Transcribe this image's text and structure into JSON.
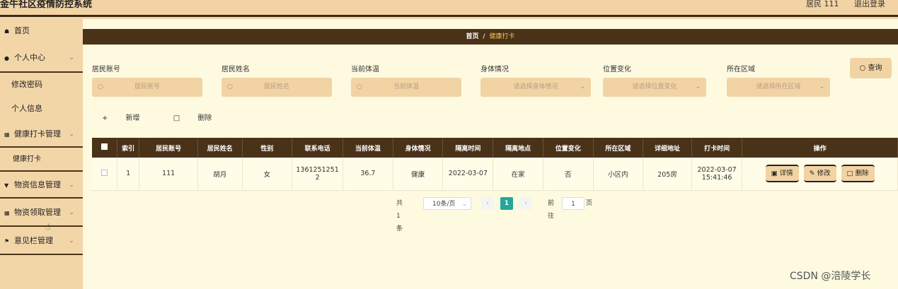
{
  "header": {
    "title": "金牛社区疫情防控系统",
    "user": "居民 111",
    "logout": "退出登录"
  },
  "sidebar": {
    "items": [
      {
        "label": "首页"
      },
      {
        "label": "个人中心"
      },
      {
        "label": "修改密码"
      },
      {
        "label": "个人信息"
      },
      {
        "label": "健康打卡管理"
      },
      {
        "label": "健康打卡"
      },
      {
        "label": "物资信息管理"
      },
      {
        "label": "物资领取管理"
      },
      {
        "label": "意见栏管理"
      }
    ]
  },
  "breadcrumb": {
    "home": "首页",
    "sep": "/",
    "current": "健康打卡"
  },
  "filters": {
    "account": {
      "label": "居民账号",
      "placeholder": "居民账号"
    },
    "name": {
      "label": "居民姓名",
      "placeholder": "居民姓名"
    },
    "temp": {
      "label": "当前体温",
      "placeholder": "当前体温"
    },
    "body": {
      "label": "身体情况",
      "placeholder": "请选择身体情况"
    },
    "location": {
      "label": "位置变化",
      "placeholder": "请选择位置变化"
    },
    "area": {
      "label": "所在区域",
      "placeholder": "请选择所在区域"
    },
    "query": "查询"
  },
  "actions": {
    "add": "新增",
    "delete": "删除"
  },
  "table": {
    "headers": [
      "索引",
      "居民账号",
      "居民姓名",
      "性别",
      "联系电话",
      "当前体温",
      "身体情况",
      "隔离时间",
      "隔离地点",
      "位置变化",
      "所在区域",
      "详细地址",
      "打卡时间",
      "操作"
    ],
    "rows": [
      {
        "index": "1",
        "account": "111",
        "name": "胡月",
        "gender": "女",
        "phone_1": "1361251251",
        "phone_2": "2",
        "temp": "36.7",
        "body": "健康",
        "iso_time": "2022-03-07",
        "iso_place": "在家",
        "loc_change": "否",
        "area": "小区内",
        "address": "205房",
        "time_1": "2022-03-07",
        "time_2": "15:41:46",
        "op_detail": "详情",
        "op_edit": "修改",
        "op_delete": "删除"
      }
    ]
  },
  "pagination": {
    "total": "共 1 条",
    "size": "10条/页",
    "current": "1",
    "goto": "前往",
    "goto_value": "1",
    "page": "页"
  },
  "watermark": "CSDN @涪陵学长",
  "colors": {
    "header_bg": "#f2d3a4",
    "dark_brown": "#4a3218",
    "content_bg": "#fdfae0",
    "accent_gold": "#f5c35c",
    "page_active": "#26a69a"
  }
}
